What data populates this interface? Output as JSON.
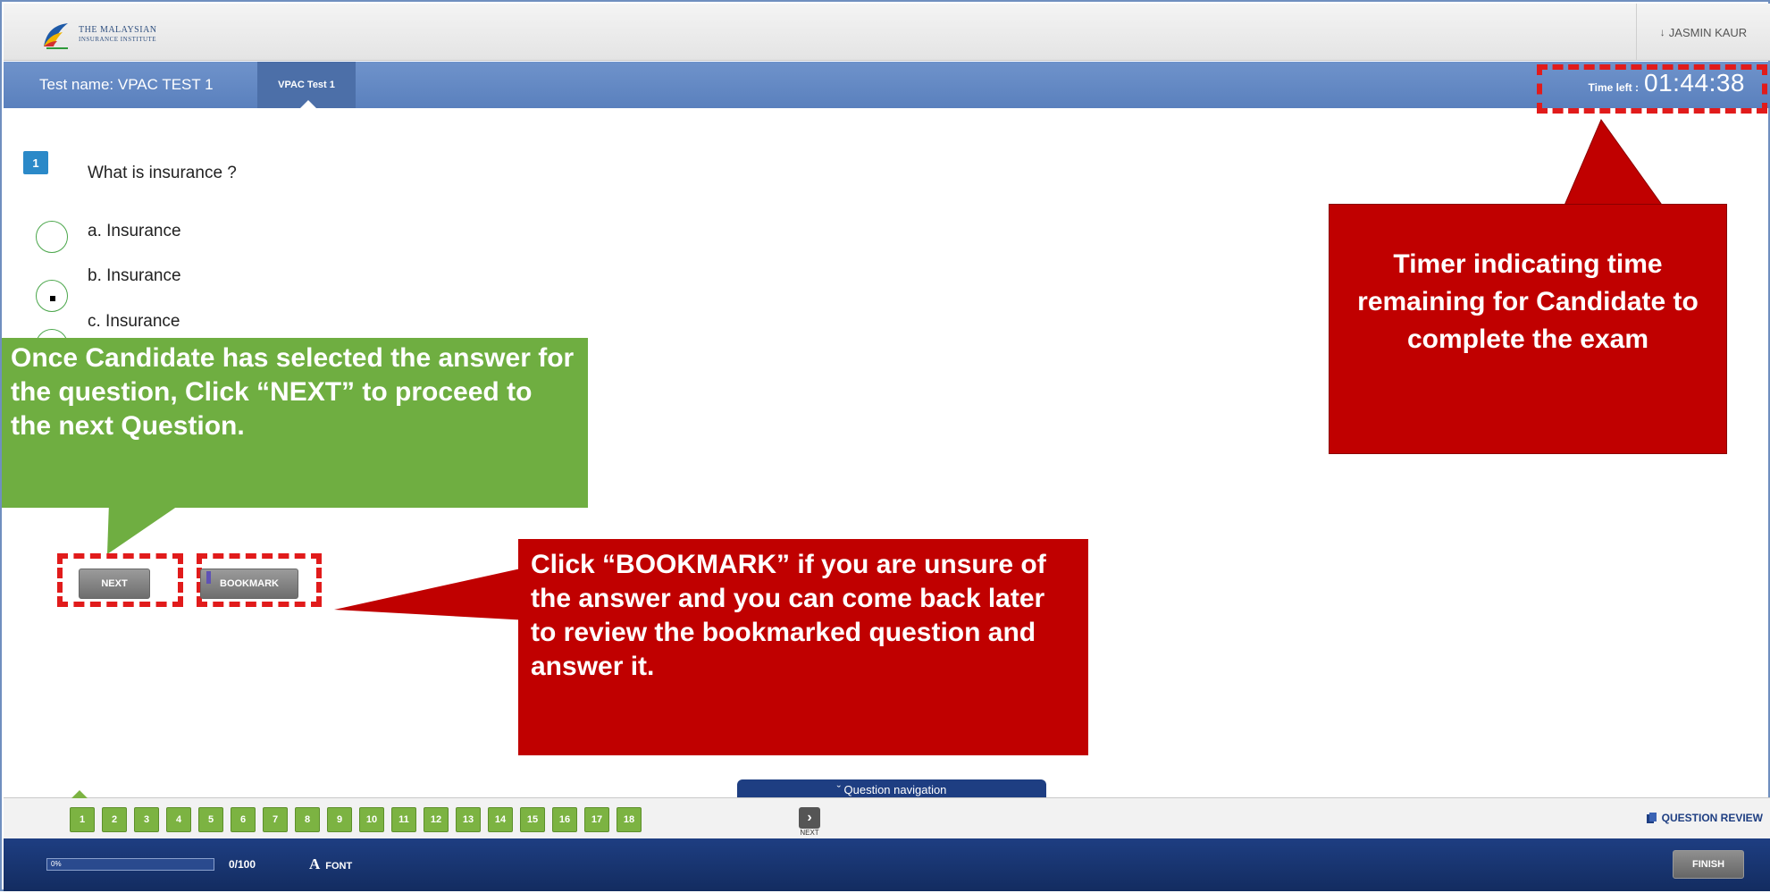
{
  "header": {
    "logo_line1": "THE MALAYSIAN",
    "logo_line2": "INSURANCE INSTITUTE",
    "user_name": "JASMIN KAUR"
  },
  "test_bar": {
    "test_name": "Test name: VPAC TEST 1",
    "tab_label": "VPAC Test 1",
    "timer_label": "Time left :",
    "timer_value": "01:44:38"
  },
  "question": {
    "number": "1",
    "text": "What is insurance ?",
    "options": [
      {
        "label": "a. Insurance",
        "selected": false
      },
      {
        "label": "b. Insurance",
        "selected": true
      },
      {
        "label": "c. Insurance",
        "selected": false
      }
    ]
  },
  "actions": {
    "next_label": "NEXT",
    "bookmark_label": "BOOKMARK"
  },
  "callouts": {
    "next_help": "Once Candidate has selected the answer for the question, Click “NEXT” to proceed to the next Question.",
    "bookmark_help": "Click “BOOKMARK” if you are unsure of the answer and you can come back later to review the bookmarked question and answer it.",
    "timer_help": "Timer indicating time remaining for Candidate to complete the exam"
  },
  "navigation": {
    "toggle_label": "ˇ Question navigation",
    "items": [
      "1",
      "2",
      "3",
      "4",
      "5",
      "6",
      "7",
      "8",
      "9",
      "10",
      "11",
      "12",
      "13",
      "14",
      "15",
      "16",
      "17",
      "18"
    ],
    "next_label": "NEXT",
    "review_label": "QUESTION REVIEW"
  },
  "status_bar": {
    "progress_percent_label": "0%",
    "progress_fraction": 0,
    "answered_count": "0/100",
    "font_glyph": "A",
    "font_label": "FONT",
    "finish_label": "FINISH"
  },
  "colors": {
    "callout_red": "#c00000",
    "callout_green": "#6fae41",
    "highlight_dash": "#e11b1b",
    "header_blue": "#5a80bd",
    "nav_green": "#7cb342"
  }
}
